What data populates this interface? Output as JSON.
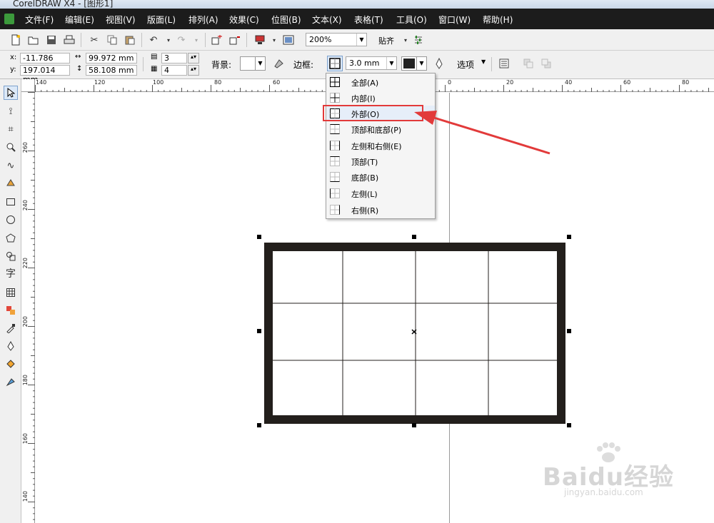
{
  "window": {
    "title": "CorelDRAW X4 - [图形1]"
  },
  "menu": [
    "文件(F)",
    "编辑(E)",
    "视图(V)",
    "版面(L)",
    "排列(A)",
    "效果(C)",
    "位图(B)",
    "文本(X)",
    "表格(T)",
    "工具(O)",
    "窗口(W)",
    "帮助(H)"
  ],
  "standard_toolbar": {
    "zoom": "200%",
    "snap_label": "贴齐"
  },
  "property_bar": {
    "x_label": "x:",
    "x_value": "-11.786 mm",
    "y_label": "y:",
    "y_value": "197.014 mm",
    "width_value": "99.972 mm",
    "height_value": "58.108 mm",
    "rows_value": "3",
    "cols_value": "4",
    "background_label": "背景:",
    "border_label": "边框:",
    "border_width": "3.0 mm",
    "options_label": "选项"
  },
  "ruler": {
    "h_ticks": [
      "140",
      "120",
      "100",
      "80",
      "60",
      "0",
      "20",
      "40",
      "60",
      "80"
    ],
    "v_ticks": [
      "260",
      "240",
      "220",
      "200",
      "180",
      "160",
      "140"
    ]
  },
  "border_menu": {
    "items": [
      "全部(A)",
      "内部(I)",
      "外部(O)",
      "顶部和底部(P)",
      "左侧和右侧(E)",
      "顶部(T)",
      "底部(B)",
      "左侧(L)",
      "右侧(R)"
    ],
    "selected_index": 2
  },
  "table": {
    "rows": 3,
    "cols": 4
  },
  "watermark": {
    "text": "Baidu经验",
    "url": "jingyan.baidu.com"
  },
  "colors": {
    "menubar": "#1c1c1c",
    "table_border": "#231f1c",
    "annotation_red": "#e23a3a"
  }
}
